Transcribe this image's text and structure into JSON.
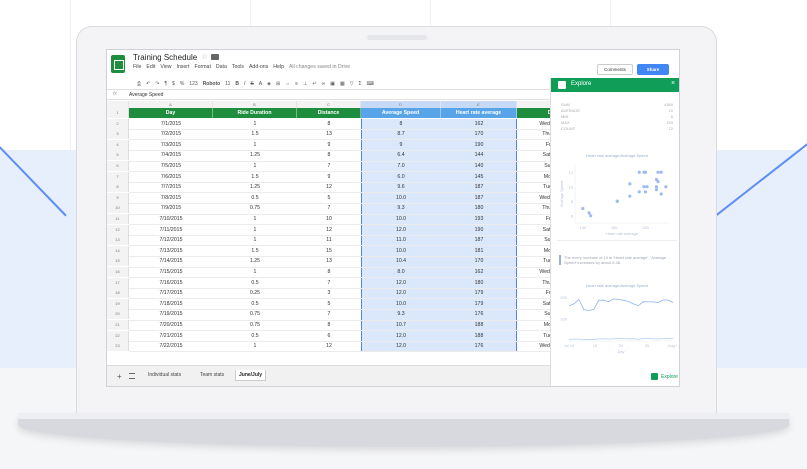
{
  "doc": {
    "title": "Training Schedule",
    "menu": [
      "File",
      "Edit",
      "View",
      "Insert",
      "Format",
      "Data",
      "Tools",
      "Add-ons",
      "Help"
    ],
    "saved_status": "All changes saved in Drive",
    "comments_label": "Comments",
    "share_label": "Share"
  },
  "toolbar": {
    "font": "Roboto",
    "font_size": "11",
    "number_format": "123"
  },
  "formula_bar": {
    "fx": "fx",
    "value": "Average Speed"
  },
  "grid": {
    "column_letters": [
      "A",
      "B",
      "C",
      "D",
      "E",
      "F"
    ],
    "headers": [
      "Day",
      "Ride Duration",
      "Distance",
      "Average Speed",
      "Heart rate average",
      "Day"
    ],
    "header_color": "#1e8e3e",
    "selection_color": "#dbe8fb",
    "rows": [
      [
        "7/1/2015",
        "1",
        "8",
        "8",
        "162",
        "Wednesday"
      ],
      [
        "7/2/2015",
        "1.5",
        "13",
        "8.7",
        "170",
        "Thursday"
      ],
      [
        "7/3/2015",
        "1",
        "9",
        "9",
        "190",
        "Friday"
      ],
      [
        "7/4/2015",
        "1.25",
        "8",
        "6.4",
        "144",
        "Saturday"
      ],
      [
        "7/5/2015",
        "1",
        "7",
        "7.0",
        "140",
        "Sunday"
      ],
      [
        "7/6/2015",
        "1.5",
        "9",
        "6.0",
        "145",
        "Monday"
      ],
      [
        "7/7/2015",
        "1.25",
        "12",
        "9.6",
        "187",
        "Tuesday"
      ],
      [
        "7/8/2015",
        "0.5",
        "5",
        "10.0",
        "187",
        "Wednesday"
      ],
      [
        "7/9/2015",
        "0.75",
        "7",
        "9.3",
        "180",
        "Thursday"
      ],
      [
        "7/10/2015",
        "1",
        "10",
        "10.0",
        "193",
        "Friday"
      ],
      [
        "7/11/2015",
        "1",
        "12",
        "12.0",
        "190",
        "Saturday"
      ],
      [
        "7/12/2015",
        "1",
        "11",
        "11.0",
        "187",
        "Sunday"
      ],
      [
        "7/13/2015",
        "1.5",
        "15",
        "10.0",
        "181",
        "Monday"
      ],
      [
        "7/14/2015",
        "1.25",
        "13",
        "10.4",
        "170",
        "Tuesday"
      ],
      [
        "7/15/2015",
        "1",
        "8",
        "8.0",
        "162",
        "Wednesday"
      ],
      [
        "7/16/2015",
        "0.5",
        "7",
        "12.0",
        "180",
        "Thursday"
      ],
      [
        "7/17/2015",
        "0.25",
        "3",
        "12.0",
        "179",
        "Friday"
      ],
      [
        "7/18/2015",
        "0.5",
        "5",
        "10.0",
        "179",
        "Saturday"
      ],
      [
        "7/19/2015",
        "0.75",
        "7",
        "9.3",
        "176",
        "Sunday"
      ],
      [
        "7/20/2015",
        "0.75",
        "8",
        "10.7",
        "188",
        "Monday"
      ],
      [
        "7/21/2015",
        "0.5",
        "6",
        "12.0",
        "188",
        "Tuesday"
      ],
      [
        "7/22/2015",
        "1",
        "12",
        "12.0",
        "176",
        "Wednesday"
      ]
    ]
  },
  "tabs": [
    "Individual stats",
    "Team stats",
    "June/July"
  ],
  "explore": {
    "title": "Explore",
    "button_label": "Explore",
    "stats": [
      {
        "label": "SUM",
        "value": "4360"
      },
      {
        "label": "AVERAGE",
        "value": "10"
      },
      {
        "label": "MIN",
        "value": "6"
      },
      {
        "label": "MAX",
        "value": "193"
      },
      {
        "label": "COUNT",
        "value": "72"
      }
    ],
    "scatter_title": "Heart rate average/Average Speed",
    "scatter_ylabel": "Average Speed",
    "scatter_xlabel": "Heart rate average",
    "scatter_yticks": [
      "12",
      "10",
      "8",
      "6"
    ],
    "scatter_xticks": [
      "140",
      "160",
      "180"
    ],
    "insight": "The every increase of 10 in 'Heart rate average', 'Average Speed' increases by about 0.38.",
    "line_title": "Heart rate average/Average Speed",
    "line_yticks": [
      "200",
      "100"
    ],
    "line_xticks": [
      "Jul 10",
      "15",
      "20",
      "25",
      "Aug 1"
    ],
    "line_xlabel": "Day",
    "accent": "#0f9d58"
  },
  "chart_data": [
    {
      "type": "scatter",
      "title": "Heart rate average/Average Speed",
      "xlabel": "Heart rate average",
      "ylabel": "Average Speed",
      "x": [
        162,
        170,
        190,
        144,
        140,
        145,
        187,
        187,
        180,
        193,
        190,
        187,
        181,
        170,
        162,
        180,
        179,
        179,
        176,
        188,
        188,
        176
      ],
      "y": [
        8,
        8.7,
        9,
        6.4,
        7.0,
        6.0,
        9.6,
        10.0,
        9.3,
        10.0,
        12.0,
        11.0,
        10.0,
        10.4,
        8.0,
        12.0,
        12.0,
        10.0,
        9.3,
        10.7,
        12.0,
        12.0
      ],
      "xlim": [
        135,
        195
      ],
      "ylim": [
        5,
        13
      ]
    },
    {
      "type": "line",
      "title": "Heart rate average/Average Speed",
      "series": [
        {
          "values": [
            162,
            170,
            190,
            144,
            140,
            145,
            187,
            187,
            180,
            193,
            190,
            187,
            181,
            170,
            162,
            180,
            179,
            179,
            176,
            188,
            188,
            176
          ]
        },
        {
          "values": [
            8,
            8.7,
            9,
            6.4,
            7.0,
            6.0,
            9.6,
            10.0,
            9.3,
            10.0,
            12.0,
            11.0,
            10.0,
            10.4,
            8.0,
            12.0,
            12.0,
            10.0,
            9.3,
            10.7,
            12.0,
            12.0
          ]
        }
      ],
      "ylim": [
        0,
        220
      ]
    }
  ]
}
